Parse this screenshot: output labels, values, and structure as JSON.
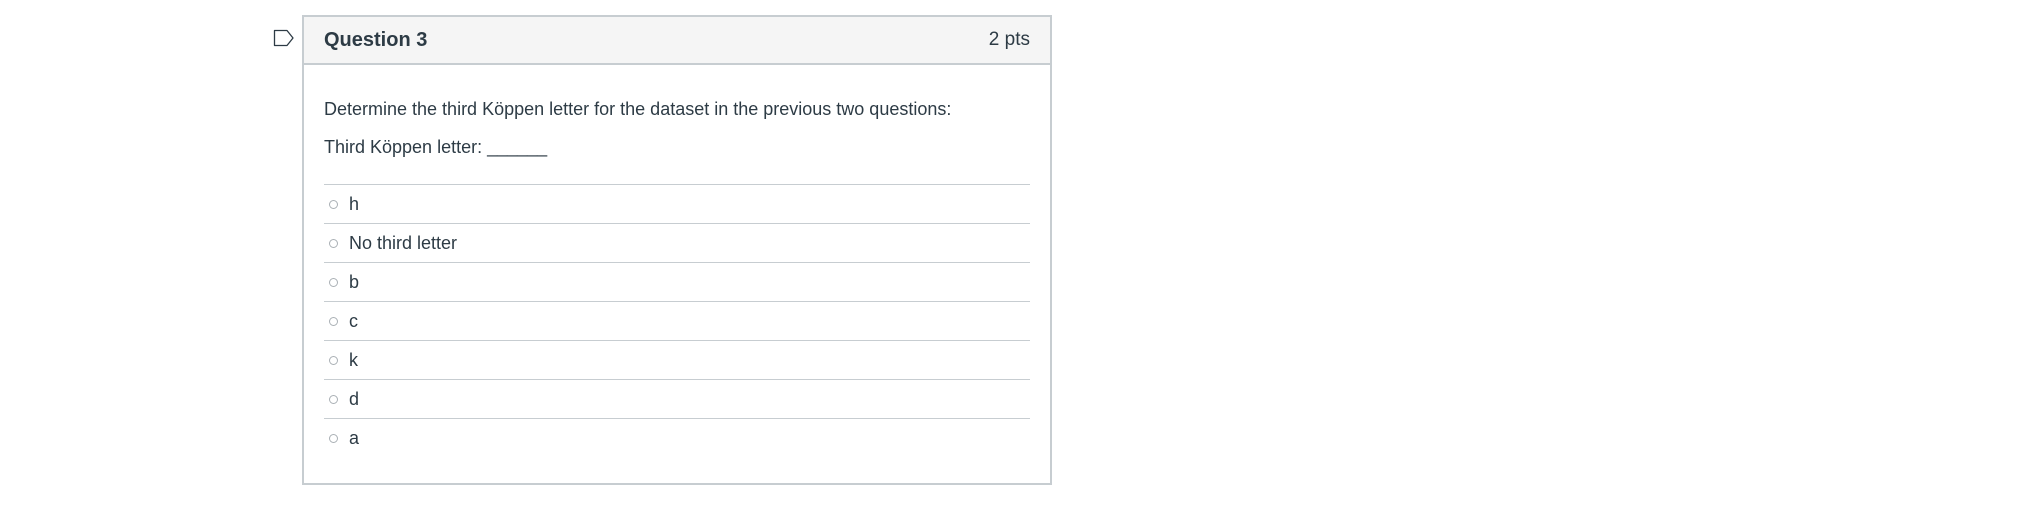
{
  "question": {
    "title": "Question 3",
    "points": "2 pts",
    "text": "Determine the third Köppen letter for the dataset in the previous two questions:",
    "prompt": "Third Köppen letter: ______"
  },
  "answers": [
    {
      "label": "h"
    },
    {
      "label": "No third letter"
    },
    {
      "label": "b"
    },
    {
      "label": "c"
    },
    {
      "label": "k"
    },
    {
      "label": "d"
    },
    {
      "label": "a"
    }
  ],
  "icons": {
    "flag": "bookmark-flag-icon"
  },
  "colors": {
    "border": "#c7cdd1",
    "header_bg": "#f5f5f5",
    "text": "#2d3b45",
    "flag": "#2d3b45"
  }
}
